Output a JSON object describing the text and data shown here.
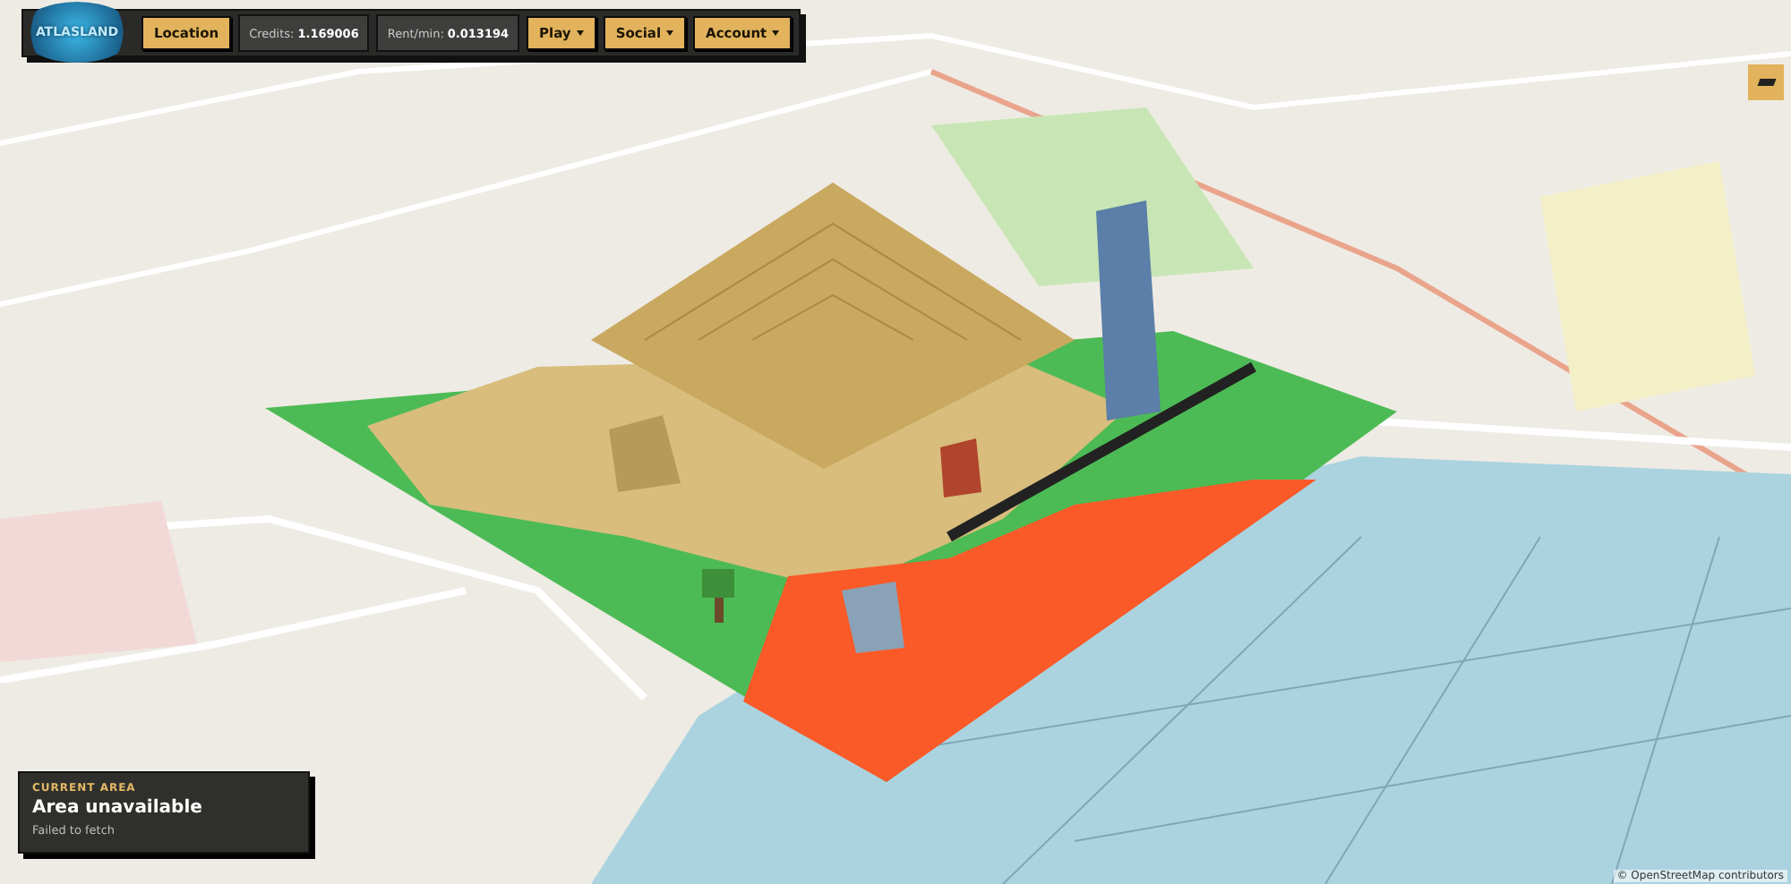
{
  "app": {
    "logo": "ATLASLAND"
  },
  "toolbar": {
    "items": [
      {
        "kind": "button",
        "label": "Location",
        "dropdown": false
      },
      {
        "kind": "stat",
        "label": "Credits:",
        "value": "1.169006"
      },
      {
        "kind": "stat",
        "label": "Rent/min:",
        "value": "0.013194"
      },
      {
        "kind": "button",
        "label": "Play",
        "dropdown": true
      },
      {
        "kind": "button",
        "label": "Social",
        "dropdown": true
      },
      {
        "kind": "button",
        "label": "Account",
        "dropdown": true
      }
    ]
  },
  "current_area": {
    "heading": "CURRENT AREA",
    "title": "Area unavailable",
    "detail": "Failed to fetch"
  },
  "attribution": "© OpenStreetMap contributors"
}
